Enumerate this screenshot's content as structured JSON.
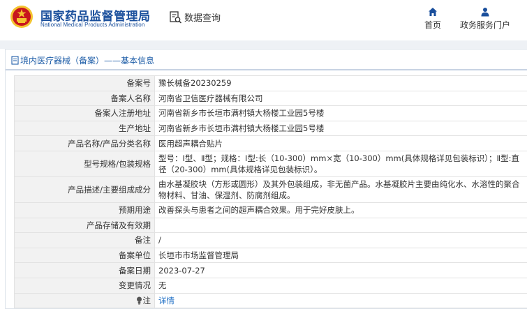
{
  "header": {
    "agency_cn": "国家药品监督管理局",
    "agency_en": "National Medical Products Administration",
    "page_title": "数据查询",
    "nav": [
      {
        "label": "首页",
        "icon": "home-icon"
      },
      {
        "label": "政务服务门户",
        "icon": "user-icon"
      }
    ]
  },
  "breadcrumb": "境内医疗器械（备案）——基本信息",
  "rows": [
    {
      "label": "备案号",
      "value": "豫长械备20230259"
    },
    {
      "label": "备案人名称",
      "value": "河南省卫信医疗器械有限公司"
    },
    {
      "label": "备案人注册地址",
      "value": "河南省新乡市长垣市满村镇大杨楼工业园5号楼"
    },
    {
      "label": "生产地址",
      "value": "河南省新乡市长垣市满村镇大杨楼工业园5号楼"
    },
    {
      "label": "产品名称/产品分类名称",
      "value": "医用超声耦合贴片"
    },
    {
      "label": "型号规格/包装规格",
      "value": "型号：Ⅰ型、Ⅱ型；规格：Ⅰ型:长（10-300）mm×宽（10-300）mm(具体规格详见包装标识）；Ⅱ型:直径（20-300）mm(具体规格详见包装标识）。"
    },
    {
      "label": "产品描述/主要组成成分",
      "value": "由水基凝胶块（方形或圆形）及其外包装组成，非无菌产品。水基凝胶片主要由纯化水、水溶性的聚合物材料、甘油、保湿剂、防腐剂组成。"
    },
    {
      "label": "预期用途",
      "value": "改善探头与患者之间的超声耦合效果。用于完好皮肤上。"
    },
    {
      "label": "产品存储及有效期",
      "value": ""
    },
    {
      "label": "备注",
      "value": "/"
    },
    {
      "label": "备案单位",
      "value": "长垣市市场监督管理局"
    },
    {
      "label": "备案日期",
      "value": "2023-07-27"
    },
    {
      "label": "变更情况",
      "value": "无"
    },
    {
      "label": "注",
      "value": "详情"
    }
  ],
  "colors": {
    "brand_blue": "#1a4f9c",
    "link_blue": "#1f6fc5",
    "label_bg": "#f2f2f2",
    "emblem_red": "#c8161d",
    "emblem_gold": "#f4c430"
  }
}
